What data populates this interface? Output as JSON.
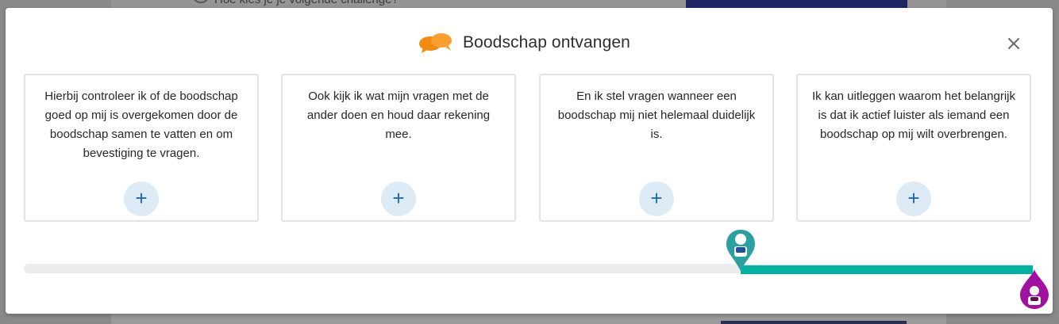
{
  "background": {
    "hint_text": "Hoe kies je je volgende challenge?"
  },
  "modal": {
    "title": "Boodschap ontvangen",
    "title_icon": "chat-bubbles-icon",
    "close_icon": "close-icon",
    "accent_color": "#f28a12"
  },
  "cards": [
    {
      "text": "Hierbij controleer ik of de boodschap goed op mij is overgekomen door de boodschap samen te vatten en om bevestiging te vragen.",
      "action": "+"
    },
    {
      "text": "Ook kijk ik wat mijn vragen met de ander doen en houd daar rekening mee.",
      "action": "+"
    },
    {
      "text": "En ik stel vragen wanneer een boodschap mij niet helemaal duidelijk is.",
      "action": "+"
    },
    {
      "text": "Ik kan uitleggen waarom het belangrijk is dat ik actief luister als iemand een boodschap op mij wilt overbrengen.",
      "action": "+"
    }
  ],
  "progress": {
    "start_fraction": 0.71,
    "end_fraction": 1.0,
    "fill_color": "#00b3a1",
    "track_color": "#ececec",
    "current_marker_icon": "person-pin-icon",
    "current_marker_color": "#2aa0a0",
    "target_marker_icon": "person-pin-icon",
    "target_marker_color": "#a0119f"
  }
}
